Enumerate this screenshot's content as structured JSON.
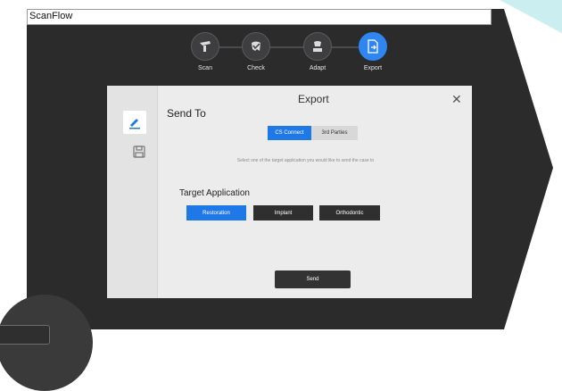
{
  "window": {
    "title": "ScanFlow"
  },
  "workflow": {
    "steps": [
      {
        "label": "Scan",
        "icon": "scanner-icon",
        "active": false
      },
      {
        "label": "Check",
        "icon": "check-tooth-icon",
        "active": false
      },
      {
        "label": "Adapt",
        "icon": "adapt-icon",
        "active": false
      },
      {
        "label": "Export",
        "icon": "export-icon",
        "active": true
      }
    ]
  },
  "dialog": {
    "title": "Export",
    "close_icon": "close-icon",
    "side_tabs": [
      {
        "icon": "send-icon",
        "active": true
      },
      {
        "icon": "save-icon",
        "active": false
      }
    ],
    "send_to_label": "Send To",
    "destination_toggle": {
      "options": [
        "CS Connect",
        "3rd Parties"
      ],
      "selected": "CS Connect"
    },
    "instruction": "Select one of the target application you would like to send the case to",
    "target_application_label": "Target Application",
    "applications": [
      {
        "label": "Restoration",
        "selected": true
      },
      {
        "label": "Implant",
        "selected": false
      },
      {
        "label": "Orthodontic",
        "selected": false
      }
    ],
    "send_button": "Send"
  },
  "colors": {
    "accent": "#1f78e8",
    "app_background": "#2b2b2c",
    "dialog_background": "#ececec"
  }
}
